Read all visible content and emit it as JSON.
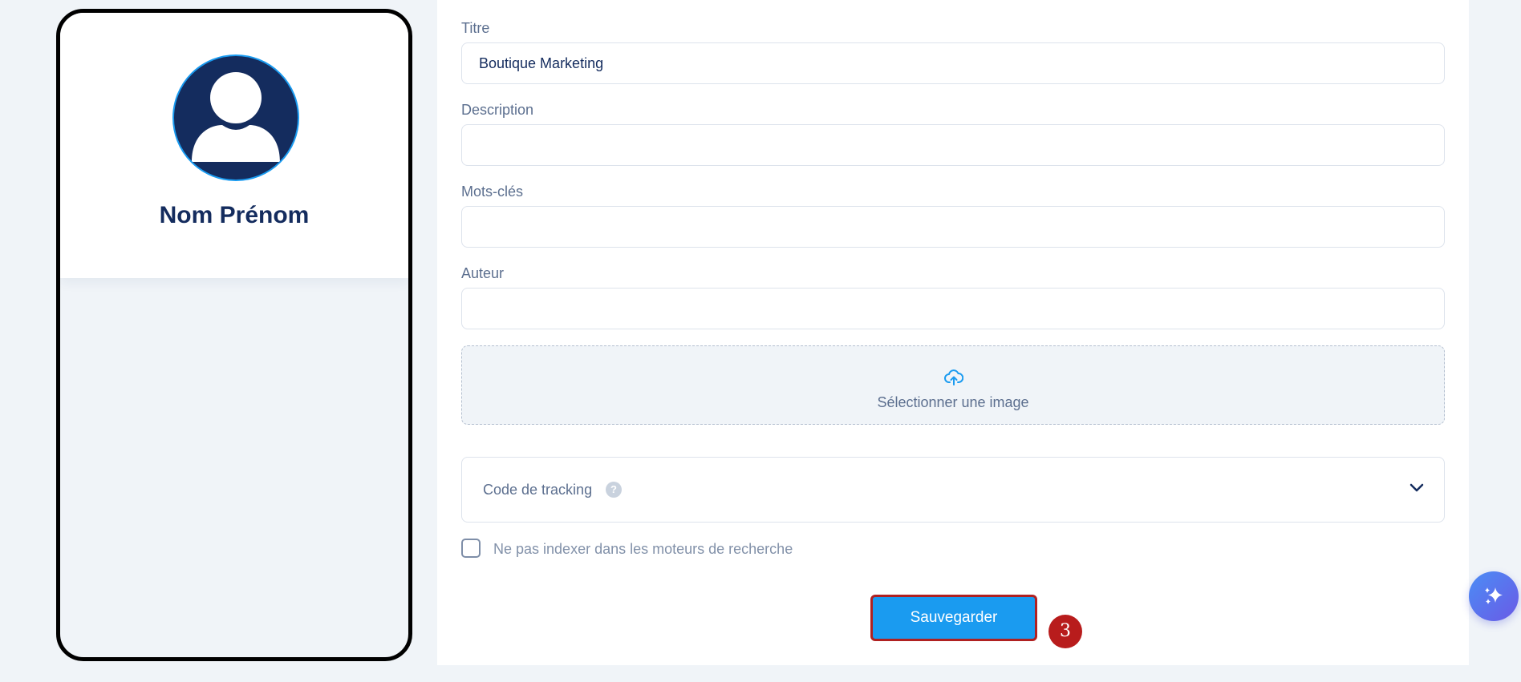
{
  "profile": {
    "name": "Nom Prénom"
  },
  "form": {
    "title_label": "Titre",
    "title_value": "Boutique Marketing",
    "description_label": "Description",
    "description_value": "",
    "keywords_label": "Mots-clés",
    "keywords_value": "",
    "author_label": "Auteur",
    "author_value": "",
    "upload_label": "Sélectionner une image",
    "tracking_label": "Code de tracking",
    "help_glyph": "?",
    "noindex_label": "Ne pas indexer dans les moteurs de recherche",
    "save_label": "Sauvegarder"
  },
  "annotation": {
    "step": "3",
    "color": "#b81c1c"
  },
  "icons": {
    "avatar": "user-silhouette-icon",
    "upload": "cloud-upload-icon",
    "help": "question-mark-icon",
    "chevron": "chevron-down-icon",
    "assistant": "sparkles-icon"
  },
  "colors": {
    "primary": "#1a9bf0",
    "navy": "#142c5e",
    "highlight_border": "#b02121"
  }
}
